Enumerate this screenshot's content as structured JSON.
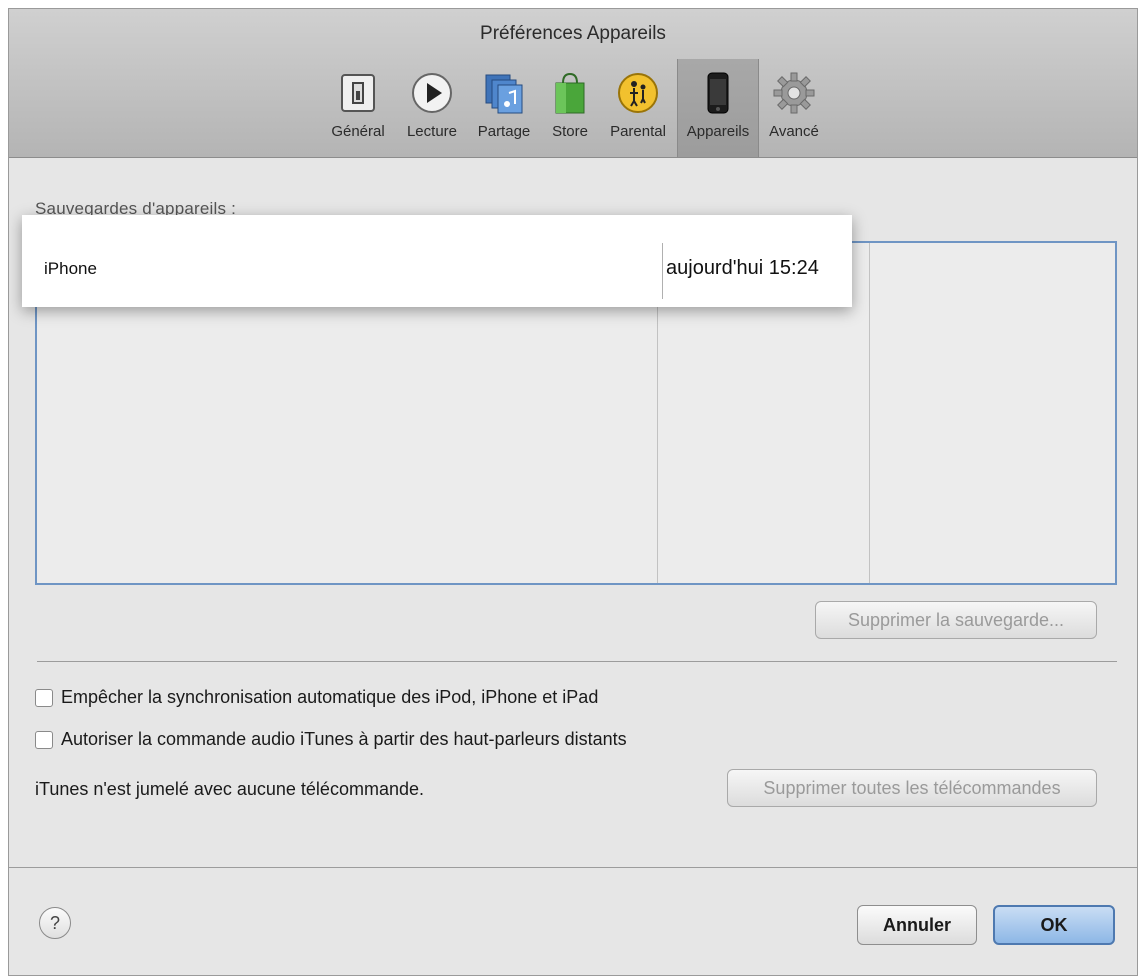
{
  "window": {
    "title": "Préférences Appareils"
  },
  "toolbar": {
    "items": [
      {
        "label": "Général",
        "icon": "general-switch-icon"
      },
      {
        "label": "Lecture",
        "icon": "play-icon"
      },
      {
        "label": "Partage",
        "icon": "share-music-icon"
      },
      {
        "label": "Store",
        "icon": "store-bag-icon"
      },
      {
        "label": "Parental",
        "icon": "parental-icon"
      },
      {
        "label": "Appareils",
        "icon": "iphone-icon",
        "selected": true
      },
      {
        "label": "Avancé",
        "icon": "gear-icon"
      }
    ]
  },
  "backups": {
    "label": "Sauvegardes d'appareils :",
    "rows": [
      {
        "device": "iPhone",
        "date": "aujourd'hui 15:24"
      }
    ],
    "delete_button": "Supprimer la sauvegarde..."
  },
  "options": {
    "prevent_sync": {
      "label": "Empêcher la synchronisation automatique des iPod, iPhone et iPad",
      "checked": false
    },
    "allow_remote_audio": {
      "label": "Autoriser la commande audio iTunes à partir des haut-parleurs distants",
      "checked": false
    },
    "remote_info": "iTunes n'est jumelé avec aucune télécommande.",
    "remove_remotes_button": "Supprimer toutes les télécommandes"
  },
  "footer": {
    "help": "?",
    "cancel": "Annuler",
    "ok": "OK"
  },
  "colors": {
    "selection_border": "#6f95c4",
    "ok_button": "#8db7e6"
  }
}
